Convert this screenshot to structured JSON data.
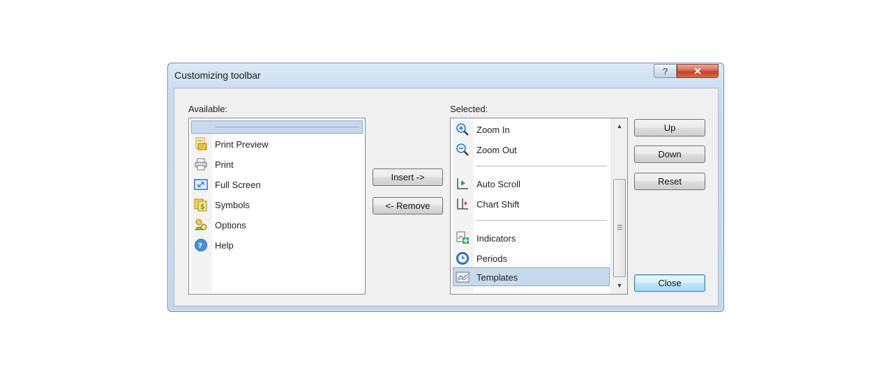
{
  "window": {
    "title": "Customizing toolbar",
    "help_glyph": "?",
    "close_glyph": "✕"
  },
  "available": {
    "label": "Available:",
    "items": [
      {
        "label": "Print Preview",
        "icon": "print-preview-icon"
      },
      {
        "label": "Print",
        "icon": "printer-icon"
      },
      {
        "label": "Full Screen",
        "icon": "full-screen-icon"
      },
      {
        "label": "Symbols",
        "icon": "symbols-icon"
      },
      {
        "label": "Options",
        "icon": "options-icon"
      },
      {
        "label": "Help",
        "icon": "help-icon"
      }
    ]
  },
  "actions": {
    "insert": "Insert ->",
    "remove": "<- Remove"
  },
  "selected": {
    "label": "Selected:",
    "items": [
      {
        "label": "Zoom In",
        "icon": "zoom-in-icon"
      },
      {
        "label": "Zoom Out",
        "icon": "zoom-out-icon"
      },
      {
        "label": "Auto Scroll",
        "icon": "auto-scroll-icon"
      },
      {
        "label": "Chart Shift",
        "icon": "chart-shift-icon"
      },
      {
        "label": "Indicators",
        "icon": "indicators-icon"
      },
      {
        "label": "Periods",
        "icon": "periods-icon"
      },
      {
        "label": "Templates",
        "icon": "templates-icon"
      }
    ],
    "selected_item": "Templates"
  },
  "buttons": {
    "up": "Up",
    "down": "Down",
    "reset": "Reset",
    "close": "Close"
  },
  "colors": {
    "selection": "#c9d9ec",
    "accent": "#3c7fb1"
  }
}
